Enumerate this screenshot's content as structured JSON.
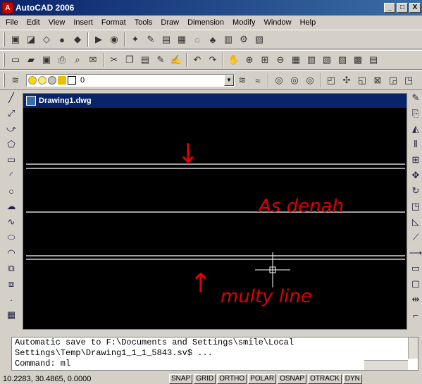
{
  "window": {
    "title": "AutoCAD 2006",
    "buttons": [
      "_",
      "□",
      "X"
    ]
  },
  "menu": [
    "File",
    "Edit",
    "View",
    "Insert",
    "Format",
    "Tools",
    "Draw",
    "Dimension",
    "Modify",
    "Window",
    "Help"
  ],
  "layer": {
    "current": "0"
  },
  "drawing": {
    "title": "Drawing1.dwg"
  },
  "annotations": {
    "top_arrow": "↓",
    "as_denah": "As denah",
    "multyline": "multy line",
    "bottom_arrow": "↑"
  },
  "command": {
    "line1": "Automatic save to F:\\Documents and Settings\\smile\\Local",
    "line2": "Settings\\Temp\\Drawing1_1_1_5843.sv$ ...",
    "line3": "Command: ml"
  },
  "status": {
    "coords": "10.2283, 30.4865, 0.0000",
    "buttons": [
      "SNAP",
      "GRID",
      "ORTHO",
      "POLAR",
      "OSNAP",
      "OTRACK",
      "DYN"
    ]
  },
  "colors": {
    "canvas": "#000000",
    "lines": "#ffffff",
    "annotation": "#e00000",
    "title_bar": "#0a246a"
  }
}
